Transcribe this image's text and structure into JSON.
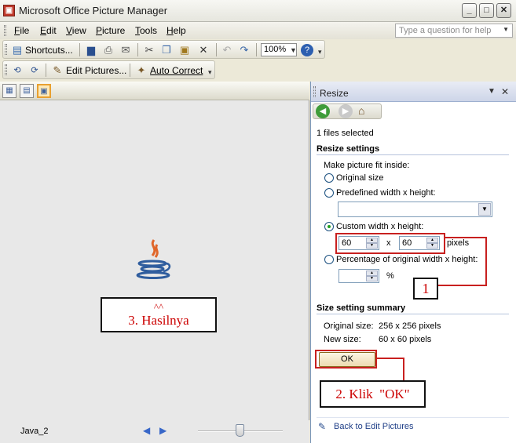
{
  "window": {
    "title": "Microsoft Office Picture Manager",
    "app_icon": "picture-manager-icon",
    "controls": [
      "minimize",
      "maximize",
      "close"
    ]
  },
  "menubar": {
    "items": [
      {
        "label": "File",
        "accel": "F"
      },
      {
        "label": "Edit",
        "accel": "E"
      },
      {
        "label": "View",
        "accel": "V"
      },
      {
        "label": "Picture",
        "accel": "P"
      },
      {
        "label": "Tools",
        "accel": "T"
      },
      {
        "label": "Help",
        "accel": "H"
      }
    ],
    "help_placeholder": "Type a question for help"
  },
  "toolbar1": {
    "shortcuts_label": "Shortcuts...",
    "zoom": "100%",
    "icons": [
      "save-icon",
      "print-icon",
      "email-icon",
      "cut-icon",
      "copy-icon",
      "paste-icon",
      "delete-icon",
      "undo-icon",
      "redo-icon",
      "help-icon"
    ]
  },
  "toolbar2": {
    "edit_pictures_label": "Edit Pictures...",
    "auto_correct_label": "Auto Correct"
  },
  "view_buttons": [
    "thumbnail-view",
    "filmstrip-view",
    "single-picture-view"
  ],
  "preview": {
    "image": "java-logo",
    "filename": "Java_2"
  },
  "task_pane": {
    "title": "Resize",
    "files_selected": "1 files selected",
    "resize_settings_heading": "Resize settings",
    "fit_inside_label": "Make picture fit inside:",
    "options": {
      "original_size": "Original size",
      "predefined": "Predefined width x height:",
      "custom": "Custom width x height:",
      "percentage": "Percentage of original width x height:"
    },
    "selected_option": "custom",
    "custom_width": "60",
    "custom_height": "60",
    "x_sep": "x",
    "pixels_label": "pixels",
    "percent_label": "%",
    "summary_heading": "Size setting summary",
    "original_size_label": "Original size:",
    "original_size_value": "256 x 256 pixels",
    "new_size_label": "New size:",
    "new_size_value": "60 x 60 pixels",
    "ok_label": "OK",
    "back_link": "Back to Edit Pictures"
  },
  "annotations": {
    "step1": "1",
    "step2": "2. Klik  \"OK\"",
    "step3_top": "^^",
    "step3": "3. Hasilnya",
    "color": "#c8201f"
  }
}
